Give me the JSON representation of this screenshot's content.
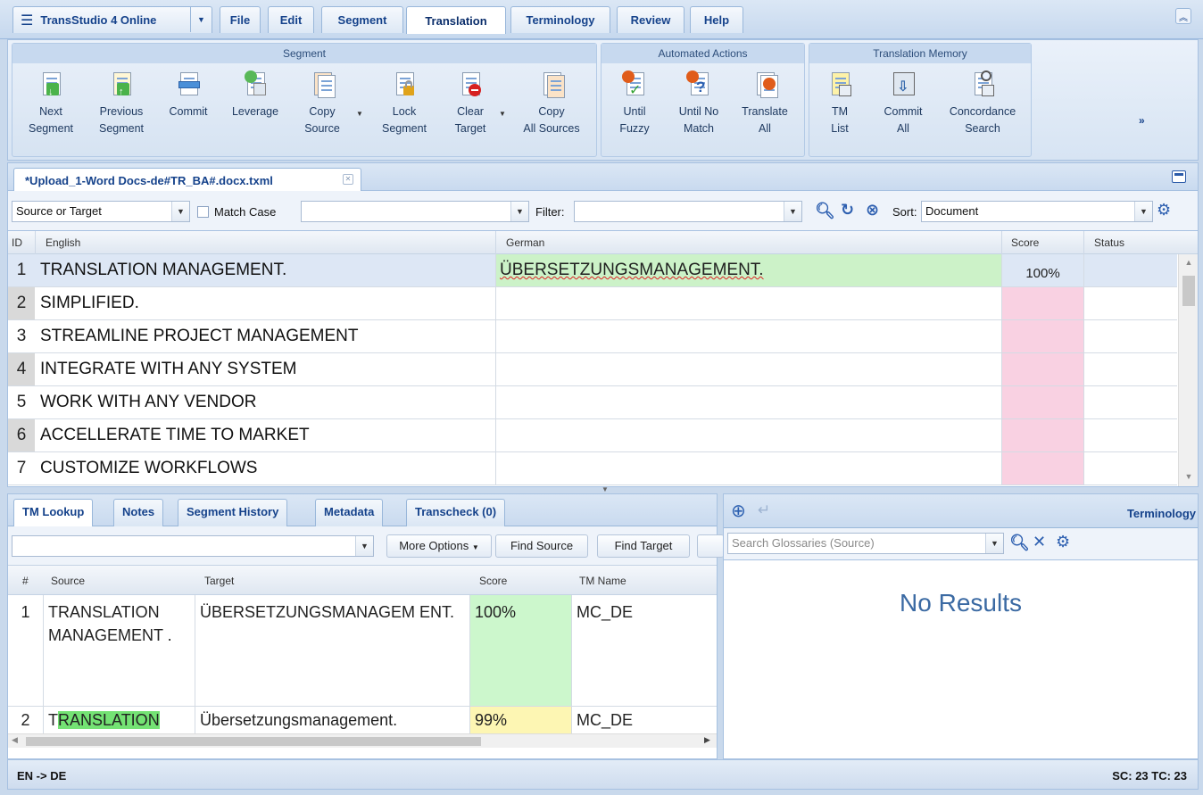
{
  "app": {
    "title": "TransStudio 4 Online",
    "menu": [
      "File",
      "Edit",
      "Segment",
      "Translation",
      "Terminology",
      "Review",
      "Help"
    ],
    "active_menu": "Translation"
  },
  "ribbon": {
    "groups": [
      {
        "title": "Segment"
      },
      {
        "title": "Automated Actions"
      },
      {
        "title": "Translation Memory"
      }
    ],
    "buttons": {
      "next_segment": [
        "Next",
        "Segment"
      ],
      "previous_segment": [
        "Previous",
        "Segment"
      ],
      "commit": [
        "Commit",
        ""
      ],
      "leverage": [
        "Leverage",
        ""
      ],
      "copy_source": [
        "Copy",
        "Source"
      ],
      "lock_segment": [
        "Lock",
        "Segment"
      ],
      "clear_target": [
        "Clear",
        "Target"
      ],
      "copy_all_sources": [
        "Copy",
        "All Sources"
      ],
      "until_fuzzy": [
        "Until",
        "Fuzzy"
      ],
      "until_no_match": [
        "Until No",
        "Match"
      ],
      "translate_all": [
        "Translate",
        "All"
      ],
      "tm_list": [
        "TM",
        "List"
      ],
      "commit_all": [
        "Commit",
        "All"
      ],
      "concordance_search": [
        "Concordance",
        "Search"
      ]
    },
    "more": "»"
  },
  "document": {
    "tab_title": "*Upload_1-Word Docs-de#TR_BA#.docx.txml"
  },
  "filterbar": {
    "search_scope": "Source or Target",
    "match_case_label": "Match Case",
    "search_value": "",
    "filter_label": "Filter:",
    "filter_value": "",
    "sort_label": "Sort:",
    "sort_value": "Document"
  },
  "grid": {
    "headers": {
      "id": "ID",
      "source": "English",
      "target": "German",
      "score": "Score",
      "status": "Status"
    },
    "rows": [
      {
        "id": "1",
        "source": "TRANSLATION MANAGEMENT.",
        "target": "ÜBERSETZUNGSMANAGEMENT.",
        "score": "100%"
      },
      {
        "id": "2",
        "source": "SIMPLIFIED.",
        "target": "",
        "score": ""
      },
      {
        "id": "3",
        "source": "STREAMLINE PROJECT MANAGEMENT",
        "target": "",
        "score": ""
      },
      {
        "id": "4",
        "source": "INTEGRATE WITH ANY SYSTEM",
        "target": "",
        "score": ""
      },
      {
        "id": "5",
        "source": "WORK WITH ANY VENDOR",
        "target": "",
        "score": ""
      },
      {
        "id": "6",
        "source": "ACCELLERATE TIME TO MARKET",
        "target": "",
        "score": ""
      },
      {
        "id": "7",
        "source": "CUSTOMIZE WORKFLOWS",
        "target": "",
        "score": ""
      }
    ]
  },
  "bottom_tabs": [
    "TM Lookup",
    "Notes",
    "Segment History",
    "Metadata",
    "Transcheck (0)"
  ],
  "tm_lookup": {
    "search_value": "",
    "more_options": "More Options",
    "find_source": "Find Source",
    "find_target": "Find Target",
    "headers": {
      "num": "#",
      "source": "Source",
      "target": "Target",
      "score": "Score",
      "tm_name": "TM Name"
    },
    "rows": [
      {
        "num": "1",
        "source": "TRANSLATION MANAGEMENT .",
        "target": "ÜBERSETZUNGSMANAGEM ENT.",
        "score": "100%",
        "tm_name": "MC_DE"
      },
      {
        "num": "2",
        "source_pre": "T",
        "source_hl": "RANSLATION",
        "target": "Übersetzungsmanagement.",
        "score": "99%",
        "tm_name": "MC_DE"
      }
    ]
  },
  "terminology": {
    "title": "Terminology",
    "search_placeholder": "Search Glossaries (Source)",
    "no_results": "No Results"
  },
  "status": {
    "lang_pair": "EN -> DE",
    "counts": "SC: 23 TC: 23"
  },
  "colors": {
    "accent": "#15428b",
    "confirmed_target": "#ccf2c8",
    "empty_score": "#f9d1e2",
    "match_100": "#ccf7cc",
    "match_fuzzy": "#fdf6b3",
    "highlight": "#74e274"
  }
}
